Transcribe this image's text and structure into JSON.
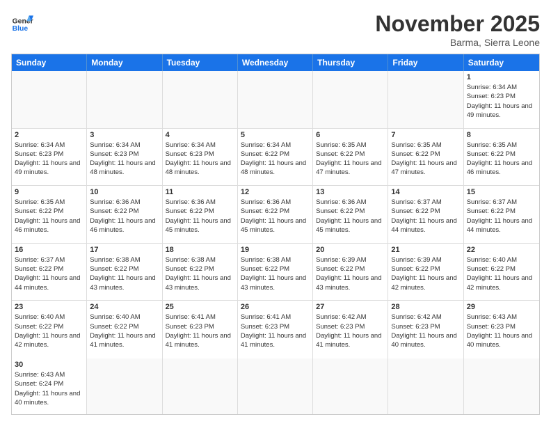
{
  "header": {
    "logo_general": "General",
    "logo_blue": "Blue",
    "month_title": "November 2025",
    "location": "Barma, Sierra Leone"
  },
  "day_headers": [
    "Sunday",
    "Monday",
    "Tuesday",
    "Wednesday",
    "Thursday",
    "Friday",
    "Saturday"
  ],
  "cells": [
    {
      "day": "",
      "empty": true,
      "text": ""
    },
    {
      "day": "",
      "empty": true,
      "text": ""
    },
    {
      "day": "",
      "empty": true,
      "text": ""
    },
    {
      "day": "",
      "empty": true,
      "text": ""
    },
    {
      "day": "",
      "empty": true,
      "text": ""
    },
    {
      "day": "",
      "empty": true,
      "text": ""
    },
    {
      "day": "1",
      "empty": false,
      "text": "Sunrise: 6:34 AM\nSunset: 6:23 PM\nDaylight: 11 hours and 49 minutes."
    },
    {
      "day": "2",
      "empty": false,
      "text": "Sunrise: 6:34 AM\nSunset: 6:23 PM\nDaylight: 11 hours and 49 minutes."
    },
    {
      "day": "3",
      "empty": false,
      "text": "Sunrise: 6:34 AM\nSunset: 6:23 PM\nDaylight: 11 hours and 48 minutes."
    },
    {
      "day": "4",
      "empty": false,
      "text": "Sunrise: 6:34 AM\nSunset: 6:23 PM\nDaylight: 11 hours and 48 minutes."
    },
    {
      "day": "5",
      "empty": false,
      "text": "Sunrise: 6:34 AM\nSunset: 6:22 PM\nDaylight: 11 hours and 48 minutes."
    },
    {
      "day": "6",
      "empty": false,
      "text": "Sunrise: 6:35 AM\nSunset: 6:22 PM\nDaylight: 11 hours and 47 minutes."
    },
    {
      "day": "7",
      "empty": false,
      "text": "Sunrise: 6:35 AM\nSunset: 6:22 PM\nDaylight: 11 hours and 47 minutes."
    },
    {
      "day": "8",
      "empty": false,
      "text": "Sunrise: 6:35 AM\nSunset: 6:22 PM\nDaylight: 11 hours and 46 minutes."
    },
    {
      "day": "9",
      "empty": false,
      "text": "Sunrise: 6:35 AM\nSunset: 6:22 PM\nDaylight: 11 hours and 46 minutes."
    },
    {
      "day": "10",
      "empty": false,
      "text": "Sunrise: 6:36 AM\nSunset: 6:22 PM\nDaylight: 11 hours and 46 minutes."
    },
    {
      "day": "11",
      "empty": false,
      "text": "Sunrise: 6:36 AM\nSunset: 6:22 PM\nDaylight: 11 hours and 45 minutes."
    },
    {
      "day": "12",
      "empty": false,
      "text": "Sunrise: 6:36 AM\nSunset: 6:22 PM\nDaylight: 11 hours and 45 minutes."
    },
    {
      "day": "13",
      "empty": false,
      "text": "Sunrise: 6:36 AM\nSunset: 6:22 PM\nDaylight: 11 hours and 45 minutes."
    },
    {
      "day": "14",
      "empty": false,
      "text": "Sunrise: 6:37 AM\nSunset: 6:22 PM\nDaylight: 11 hours and 44 minutes."
    },
    {
      "day": "15",
      "empty": false,
      "text": "Sunrise: 6:37 AM\nSunset: 6:22 PM\nDaylight: 11 hours and 44 minutes."
    },
    {
      "day": "16",
      "empty": false,
      "text": "Sunrise: 6:37 AM\nSunset: 6:22 PM\nDaylight: 11 hours and 44 minutes."
    },
    {
      "day": "17",
      "empty": false,
      "text": "Sunrise: 6:38 AM\nSunset: 6:22 PM\nDaylight: 11 hours and 43 minutes."
    },
    {
      "day": "18",
      "empty": false,
      "text": "Sunrise: 6:38 AM\nSunset: 6:22 PM\nDaylight: 11 hours and 43 minutes."
    },
    {
      "day": "19",
      "empty": false,
      "text": "Sunrise: 6:38 AM\nSunset: 6:22 PM\nDaylight: 11 hours and 43 minutes."
    },
    {
      "day": "20",
      "empty": false,
      "text": "Sunrise: 6:39 AM\nSunset: 6:22 PM\nDaylight: 11 hours and 43 minutes."
    },
    {
      "day": "21",
      "empty": false,
      "text": "Sunrise: 6:39 AM\nSunset: 6:22 PM\nDaylight: 11 hours and 42 minutes."
    },
    {
      "day": "22",
      "empty": false,
      "text": "Sunrise: 6:40 AM\nSunset: 6:22 PM\nDaylight: 11 hours and 42 minutes."
    },
    {
      "day": "23",
      "empty": false,
      "text": "Sunrise: 6:40 AM\nSunset: 6:22 PM\nDaylight: 11 hours and 42 minutes."
    },
    {
      "day": "24",
      "empty": false,
      "text": "Sunrise: 6:40 AM\nSunset: 6:22 PM\nDaylight: 11 hours and 41 minutes."
    },
    {
      "day": "25",
      "empty": false,
      "text": "Sunrise: 6:41 AM\nSunset: 6:23 PM\nDaylight: 11 hours and 41 minutes."
    },
    {
      "day": "26",
      "empty": false,
      "text": "Sunrise: 6:41 AM\nSunset: 6:23 PM\nDaylight: 11 hours and 41 minutes."
    },
    {
      "day": "27",
      "empty": false,
      "text": "Sunrise: 6:42 AM\nSunset: 6:23 PM\nDaylight: 11 hours and 41 minutes."
    },
    {
      "day": "28",
      "empty": false,
      "text": "Sunrise: 6:42 AM\nSunset: 6:23 PM\nDaylight: 11 hours and 40 minutes."
    },
    {
      "day": "29",
      "empty": false,
      "text": "Sunrise: 6:43 AM\nSunset: 6:23 PM\nDaylight: 11 hours and 40 minutes."
    },
    {
      "day": "30",
      "empty": false,
      "text": "Sunrise: 6:43 AM\nSunset: 6:24 PM\nDaylight: 11 hours and 40 minutes."
    },
    {
      "day": "",
      "empty": true,
      "text": ""
    },
    {
      "day": "",
      "empty": true,
      "text": ""
    },
    {
      "day": "",
      "empty": true,
      "text": ""
    },
    {
      "day": "",
      "empty": true,
      "text": ""
    },
    {
      "day": "",
      "empty": true,
      "text": ""
    },
    {
      "day": "",
      "empty": true,
      "text": ""
    }
  ]
}
